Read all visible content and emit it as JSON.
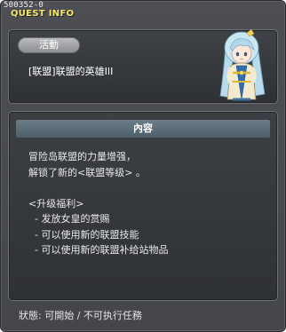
{
  "window": {
    "quest_id": "500352-0",
    "title": "QUEST INFO"
  },
  "header": {
    "category_label": "活動",
    "quest_name": "[联盟]联盟的英雄III",
    "npc_icon": "npc-portrait-icon"
  },
  "content": {
    "header_label": "內容",
    "lines": [
      "冒险岛联盟的力量增强，",
      "解锁了新的<联盟等级> 。",
      "",
      "<升级福利>",
      "  - 发放女皇的赏赐",
      "  - 可以使用新的联盟技能",
      "  - 可以使用新的联盟补给站物品"
    ]
  },
  "status": {
    "text": "狀態: 可開始 / 不可执行任務"
  },
  "colors": {
    "title_yellow": "#f4ea68",
    "panel_border": "#6d7076",
    "content_header": "#5a6c77"
  }
}
